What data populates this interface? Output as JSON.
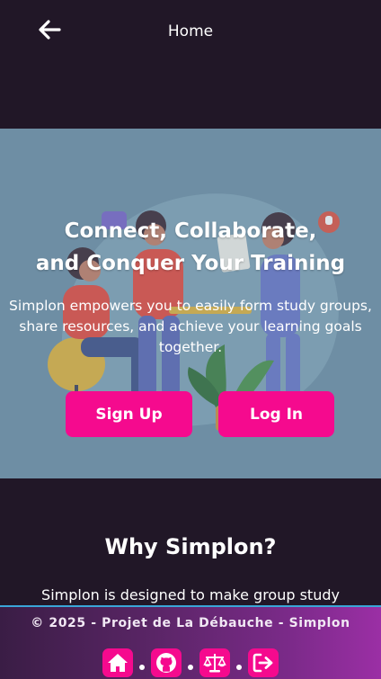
{
  "header": {
    "title": "Home",
    "back_icon": "arrow-left-icon"
  },
  "hero": {
    "title_line1": "Connect, Collaborate,",
    "title_line2": "and Conquer Your Training",
    "description": "Simplon empowers you to easily form study groups, share resources, and achieve your learning goals together.",
    "signup_label": "Sign Up",
    "login_label": "Log In"
  },
  "why": {
    "title": "Why Simplon?",
    "text": "Simplon is designed to make group study"
  },
  "footer": {
    "copyright": "© 2025 - Projet de La Débauche - Simplon",
    "icons": [
      "home-icon",
      "github-icon",
      "scale-icon",
      "logout-icon"
    ]
  },
  "colors": {
    "accent": "#f50a8e",
    "background": "#211727",
    "hero_bg": "#6e8ea4"
  }
}
